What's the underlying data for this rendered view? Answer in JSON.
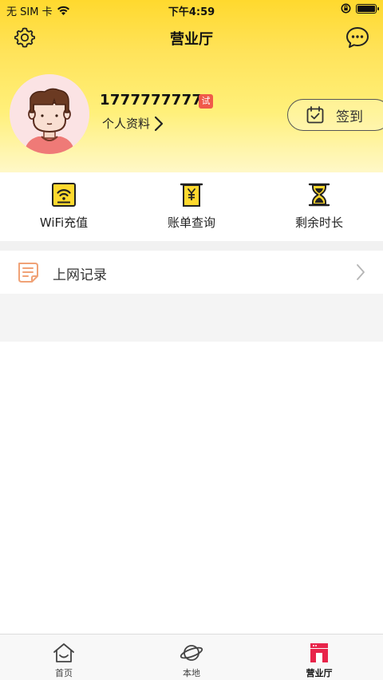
{
  "status_bar": {
    "carrier": "无 SIM 卡",
    "time": "下午4:59",
    "battery_level": 0.95
  },
  "nav": {
    "title": "营业厅",
    "left_icon": "gear-icon",
    "right_icon": "chat-bubble-icon"
  },
  "profile": {
    "phone": "17777777776",
    "badge": "试",
    "link_label": "个人资料",
    "signin_label": "签到"
  },
  "quick_actions": [
    {
      "label": "WiFi充值",
      "icon": "wifi-recharge-icon"
    },
    {
      "label": "账单查询",
      "icon": "bill-query-icon"
    },
    {
      "label": "剩余时长",
      "icon": "hourglass-icon"
    }
  ],
  "records": {
    "label": "上网记录",
    "icon": "record-list-icon"
  },
  "tabbar": [
    {
      "label": "首页",
      "icon": "home-icon"
    },
    {
      "label": "本地",
      "icon": "planet-icon"
    },
    {
      "label": "营业厅",
      "icon": "store-icon",
      "active": true
    }
  ],
  "colors": {
    "brand_yellow": "#ffd92e",
    "accent_red": "#e8244a",
    "badge_red": "#f05a4a",
    "record_icon": "#f0a277"
  }
}
